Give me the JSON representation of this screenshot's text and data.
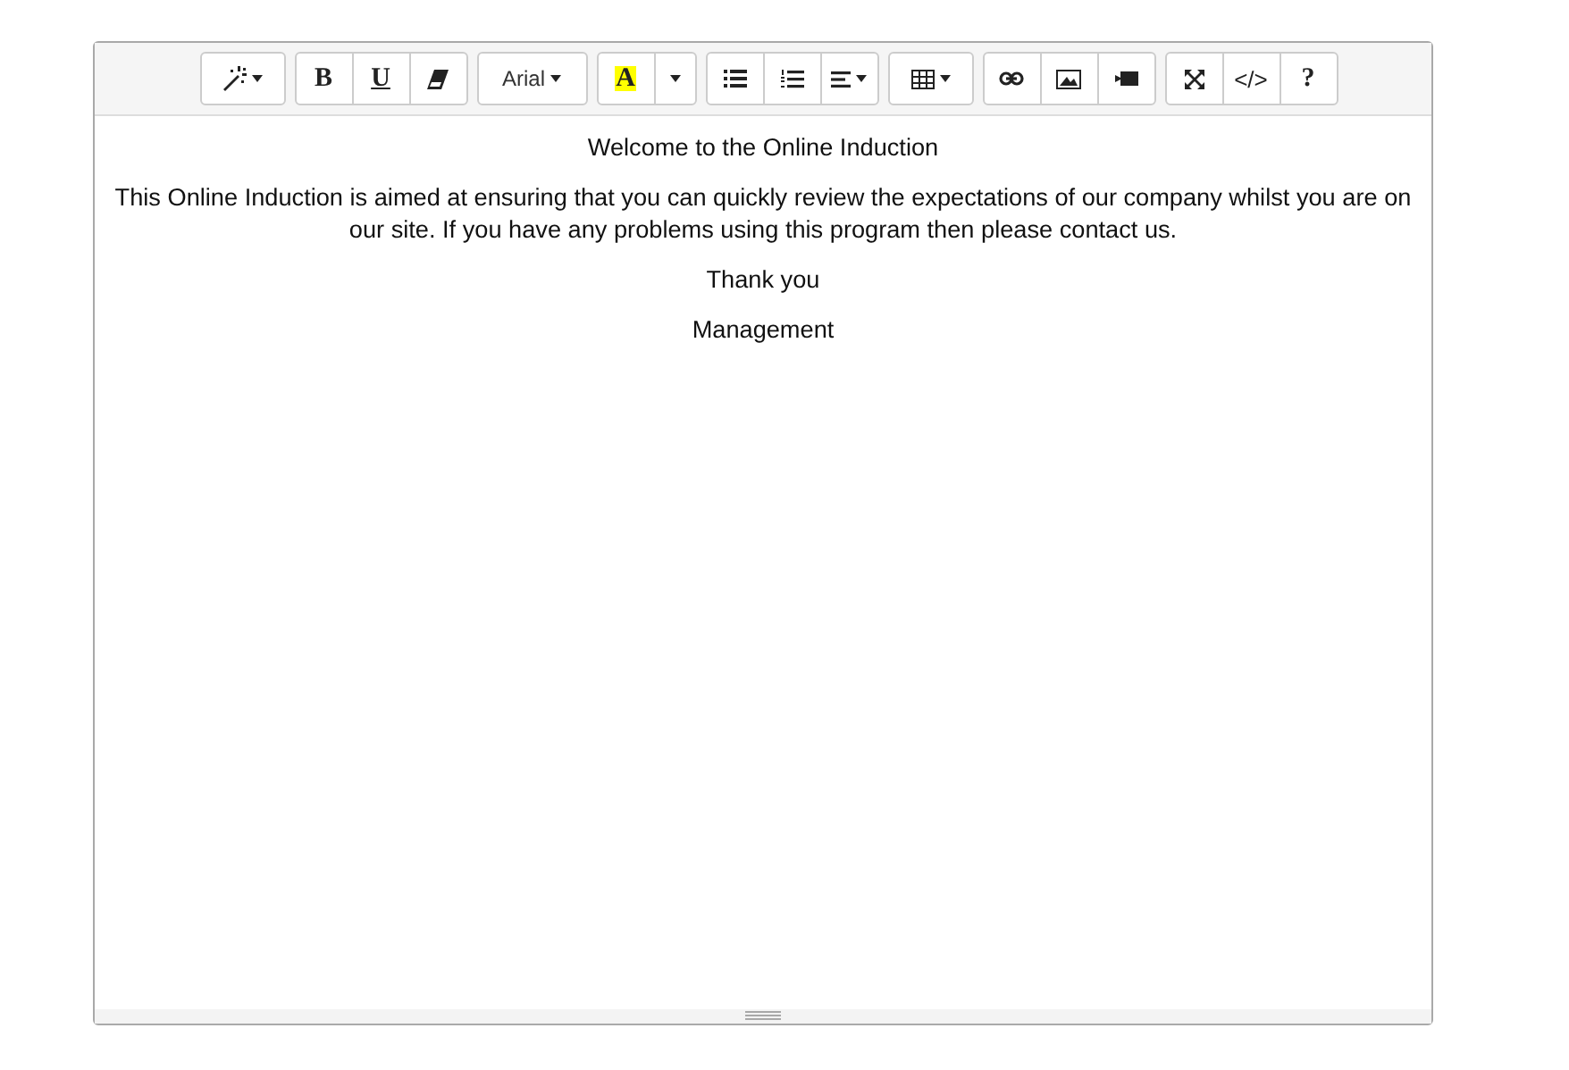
{
  "toolbar": {
    "groups": [
      {
        "buttons": [
          {
            "kind": "magic"
          }
        ]
      },
      {
        "buttons": [
          {
            "kind": "bold",
            "label": "B"
          },
          {
            "kind": "underline",
            "label": "U"
          },
          {
            "kind": "eraser"
          }
        ]
      },
      {
        "buttons": [
          {
            "kind": "font",
            "label": "Arial"
          }
        ]
      },
      {
        "buttons": [
          {
            "kind": "highlight",
            "label": "A"
          },
          {
            "kind": "dropdown"
          }
        ]
      },
      {
        "buttons": [
          {
            "kind": "bullets"
          },
          {
            "kind": "numbers"
          },
          {
            "kind": "align"
          }
        ]
      },
      {
        "buttons": [
          {
            "kind": "table"
          }
        ]
      },
      {
        "buttons": [
          {
            "kind": "link"
          },
          {
            "kind": "picture"
          },
          {
            "kind": "video"
          }
        ]
      },
      {
        "buttons": [
          {
            "kind": "fullscreen"
          },
          {
            "kind": "code",
            "label": "</>"
          },
          {
            "kind": "help",
            "label": "?"
          }
        ]
      }
    ]
  },
  "content": {
    "paragraphs": [
      "Welcome to the Online Induction",
      "This Online Induction is aimed at ensuring that you can quickly review the expectations of our company whilst you are on our site. If you have any problems using this program then please contact us.",
      "Thank you",
      "Management"
    ]
  }
}
